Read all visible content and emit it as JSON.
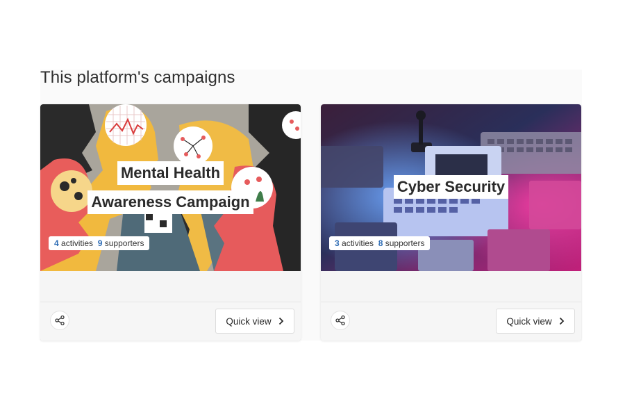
{
  "section": {
    "title": "This platform's campaigns"
  },
  "campaigns": [
    {
      "title_line1": "Mental Health",
      "title_line2": "Awareness Campaign",
      "activities_count": "4",
      "activities_label": "activities",
      "supporters_count": "9",
      "supporters_label": "supporters",
      "quick_view_label": "Quick view"
    },
    {
      "title_line1": "Cyber Security",
      "activities_count": "3",
      "activities_label": "activities",
      "supporters_count": "8",
      "supporters_label": "supporters",
      "quick_view_label": "Quick view"
    }
  ],
  "icons": {
    "share": "share-icon",
    "chevron": "chevron-right-icon"
  },
  "colors": {
    "accent": "#2f6db5",
    "card_bg": "#f5f5f5",
    "text": "#2b2b2b"
  }
}
